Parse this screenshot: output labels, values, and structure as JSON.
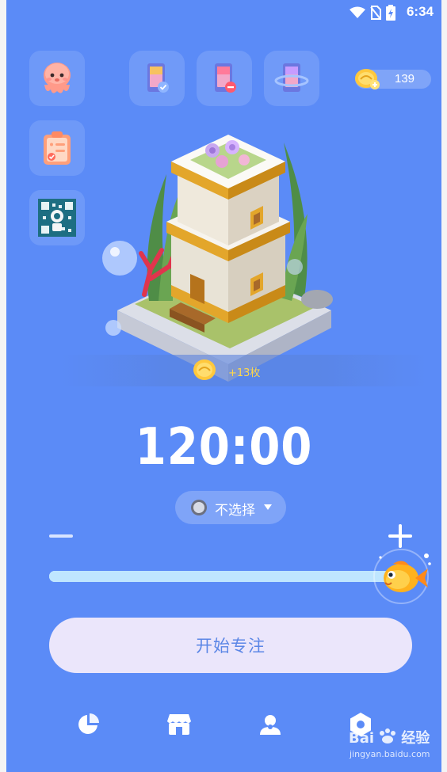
{
  "status_bar": {
    "time": "6:34"
  },
  "coins": {
    "count": "139"
  },
  "reward": {
    "text": "+13枚"
  },
  "timer": {
    "display": "120:00"
  },
  "selector": {
    "label": "不选择"
  },
  "slider": {
    "level": 1.0
  },
  "start_button": {
    "label": "开始专注"
  },
  "watermark": {
    "brand": "Bai",
    "brand2": "经验",
    "url": "jingyan.baidu.com"
  },
  "colors": {
    "background": "#5b8bf7",
    "button_bg": "#ebe6fb",
    "button_text": "#5b86e6",
    "coin": "#ffc83d"
  },
  "icons": {
    "top_left": [
      "octopus-avatar-icon",
      "clipboard-icon",
      "qr-code-icon"
    ],
    "tools": [
      "phone-check-icon",
      "phone-minus-icon",
      "phone-rotate-icon"
    ],
    "nav": [
      "pie-chart-icon",
      "store-icon",
      "profile-icon",
      "settings-icon"
    ]
  }
}
